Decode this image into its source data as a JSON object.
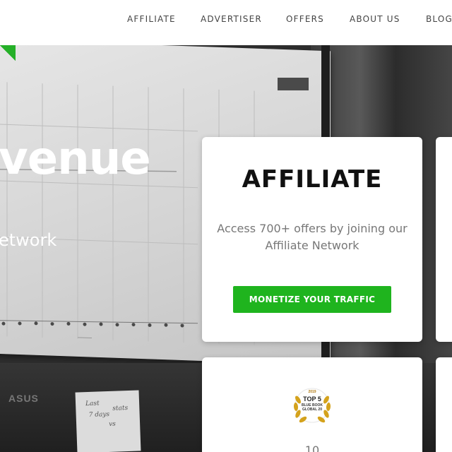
{
  "nav": {
    "items": [
      {
        "label": "AFFILIATE"
      },
      {
        "label": "ADVERTISER"
      },
      {
        "label": "OFFERS"
      },
      {
        "label": "ABOUT US"
      },
      {
        "label": "BLOG"
      }
    ]
  },
  "hero": {
    "title": "venue",
    "subtitle": "etwork",
    "monitor_brand": "ASUS",
    "sticky_note_lines": [
      "Last",
      "7 days",
      "vs",
      "stats"
    ]
  },
  "cards": {
    "affiliate": {
      "title": "AFFILIATE",
      "description": "Access 700+ offers by joining our Affiliate Network",
      "button_label": "MONETIZE YOUR TRAFFIC"
    },
    "award": {
      "year": "2019",
      "top": "TOP 5",
      "line1": "BLUE BOOK",
      "line2": "GLOBAL 20"
    },
    "bottom_text": "10"
  },
  "colors": {
    "accent_green": "#1fb41e",
    "nav_text": "#444444",
    "card_title": "#111111",
    "card_desc": "#777777"
  }
}
